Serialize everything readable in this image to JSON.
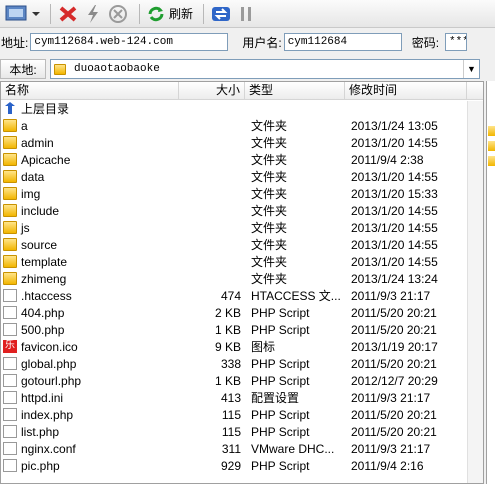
{
  "toolbar": {
    "refresh_label": "刷新"
  },
  "address": {
    "host_label": "地址:",
    "host_value": "cym112684.web-124.com",
    "user_label": "用户名:",
    "user_value": "cym112684",
    "pass_label": "密码:",
    "pass_value": "***"
  },
  "local": {
    "label": "本地:",
    "path": "duoaotaobaoke"
  },
  "columns": {
    "name": "名称",
    "size": "大小",
    "type": "类型",
    "date": "修改时间"
  },
  "parent_dir": "上层目录",
  "files": [
    {
      "name": "a",
      "size": "",
      "type": "文件夹",
      "date": "2013/1/24 13:05",
      "icon": "folder"
    },
    {
      "name": "admin",
      "size": "",
      "type": "文件夹",
      "date": "2013/1/20 14:55",
      "icon": "folder"
    },
    {
      "name": "Apicache",
      "size": "",
      "type": "文件夹",
      "date": "2011/9/4 2:38",
      "icon": "folder"
    },
    {
      "name": "data",
      "size": "",
      "type": "文件夹",
      "date": "2013/1/20 14:55",
      "icon": "folder"
    },
    {
      "name": "img",
      "size": "",
      "type": "文件夹",
      "date": "2013/1/20 15:33",
      "icon": "folder"
    },
    {
      "name": "include",
      "size": "",
      "type": "文件夹",
      "date": "2013/1/20 14:55",
      "icon": "folder"
    },
    {
      "name": "js",
      "size": "",
      "type": "文件夹",
      "date": "2013/1/20 14:55",
      "icon": "folder"
    },
    {
      "name": "source",
      "size": "",
      "type": "文件夹",
      "date": "2013/1/20 14:55",
      "icon": "folder"
    },
    {
      "name": "template",
      "size": "",
      "type": "文件夹",
      "date": "2013/1/20 14:55",
      "icon": "folder"
    },
    {
      "name": "zhimeng",
      "size": "",
      "type": "文件夹",
      "date": "2013/1/24 13:24",
      "icon": "folder"
    },
    {
      "name": ".htaccess",
      "size": "474",
      "type": "HTACCESS 文...",
      "date": "2011/9/3 21:17",
      "icon": "doc"
    },
    {
      "name": "404.php",
      "size": "2 KB",
      "type": "PHP Script",
      "date": "2011/5/20 20:21",
      "icon": "doc"
    },
    {
      "name": "500.php",
      "size": "1 KB",
      "type": "PHP Script",
      "date": "2011/5/20 20:21",
      "icon": "doc"
    },
    {
      "name": "favicon.ico",
      "size": "9 KB",
      "type": "图标",
      "date": "2013/1/19 20:17",
      "icon": "le"
    },
    {
      "name": "global.php",
      "size": "338",
      "type": "PHP Script",
      "date": "2011/5/20 20:21",
      "icon": "doc"
    },
    {
      "name": "gotourl.php",
      "size": "1 KB",
      "type": "PHP Script",
      "date": "2012/12/7 20:29",
      "icon": "doc"
    },
    {
      "name": "httpd.ini",
      "size": "413",
      "type": "配置设置",
      "date": "2011/9/3 21:17",
      "icon": "doc"
    },
    {
      "name": "index.php",
      "size": "115",
      "type": "PHP Script",
      "date": "2011/5/20 20:21",
      "icon": "doc"
    },
    {
      "name": "list.php",
      "size": "115",
      "type": "PHP Script",
      "date": "2011/5/20 20:21",
      "icon": "doc"
    },
    {
      "name": "nginx.conf",
      "size": "311",
      "type": "VMware DHC...",
      "date": "2011/9/3 21:17",
      "icon": "doc"
    },
    {
      "name": "pic.php",
      "size": "929",
      "type": "PHP Script",
      "date": "2011/9/4 2:16",
      "icon": "doc"
    }
  ]
}
